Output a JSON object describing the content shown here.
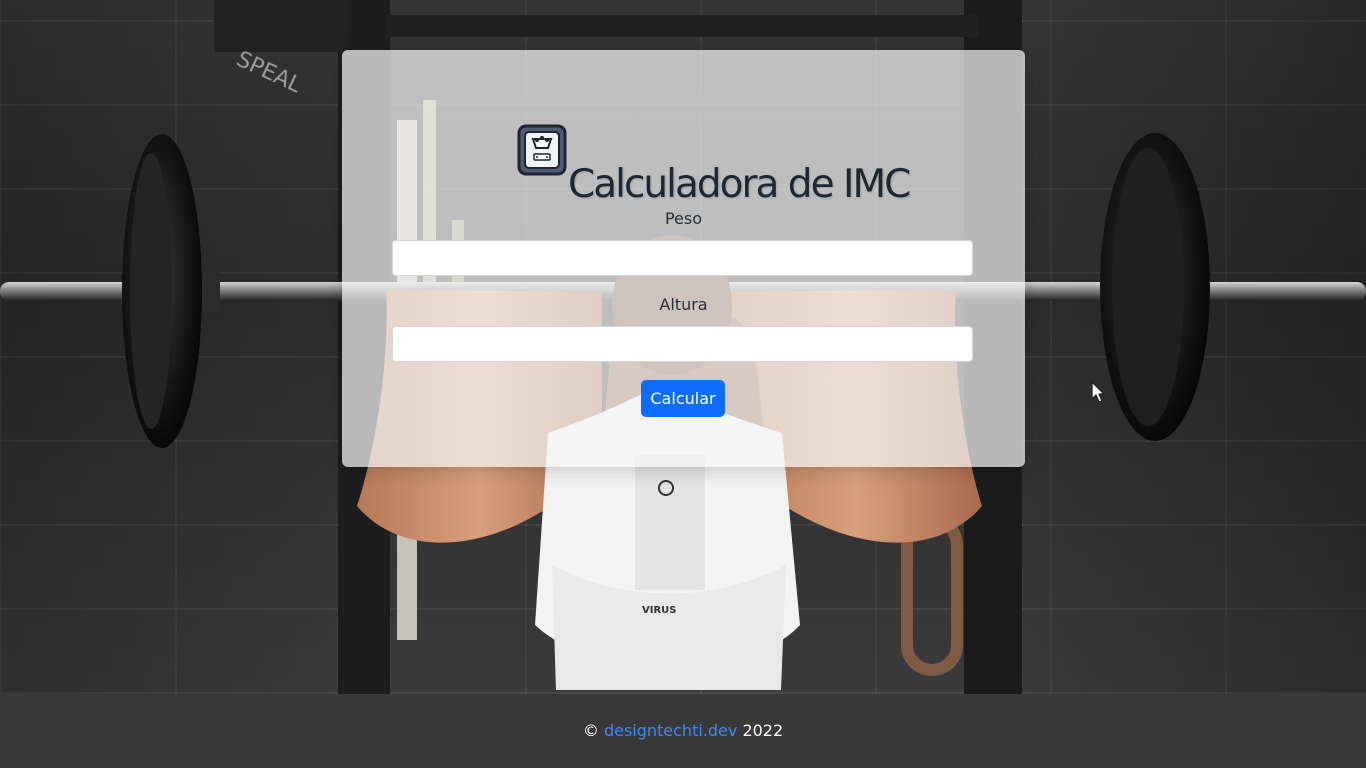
{
  "app": {
    "title": "Calculadora de IMC"
  },
  "form": {
    "weight_label": "Peso",
    "weight_value": "",
    "weight_placeholder": "",
    "height_label": "Altura",
    "height_value": "",
    "height_placeholder": "",
    "submit_label": "Calcular"
  },
  "footer": {
    "copyright_symbol": "©",
    "link_text": "designtechti.dev",
    "year": "2022"
  },
  "icons": {
    "title": "scale-icon"
  },
  "colors": {
    "accent": "#0d6efd",
    "footer_background": "#393939",
    "footer_link": "#3d89f4",
    "card_background": "rgba(245,245,245,0.72)"
  }
}
